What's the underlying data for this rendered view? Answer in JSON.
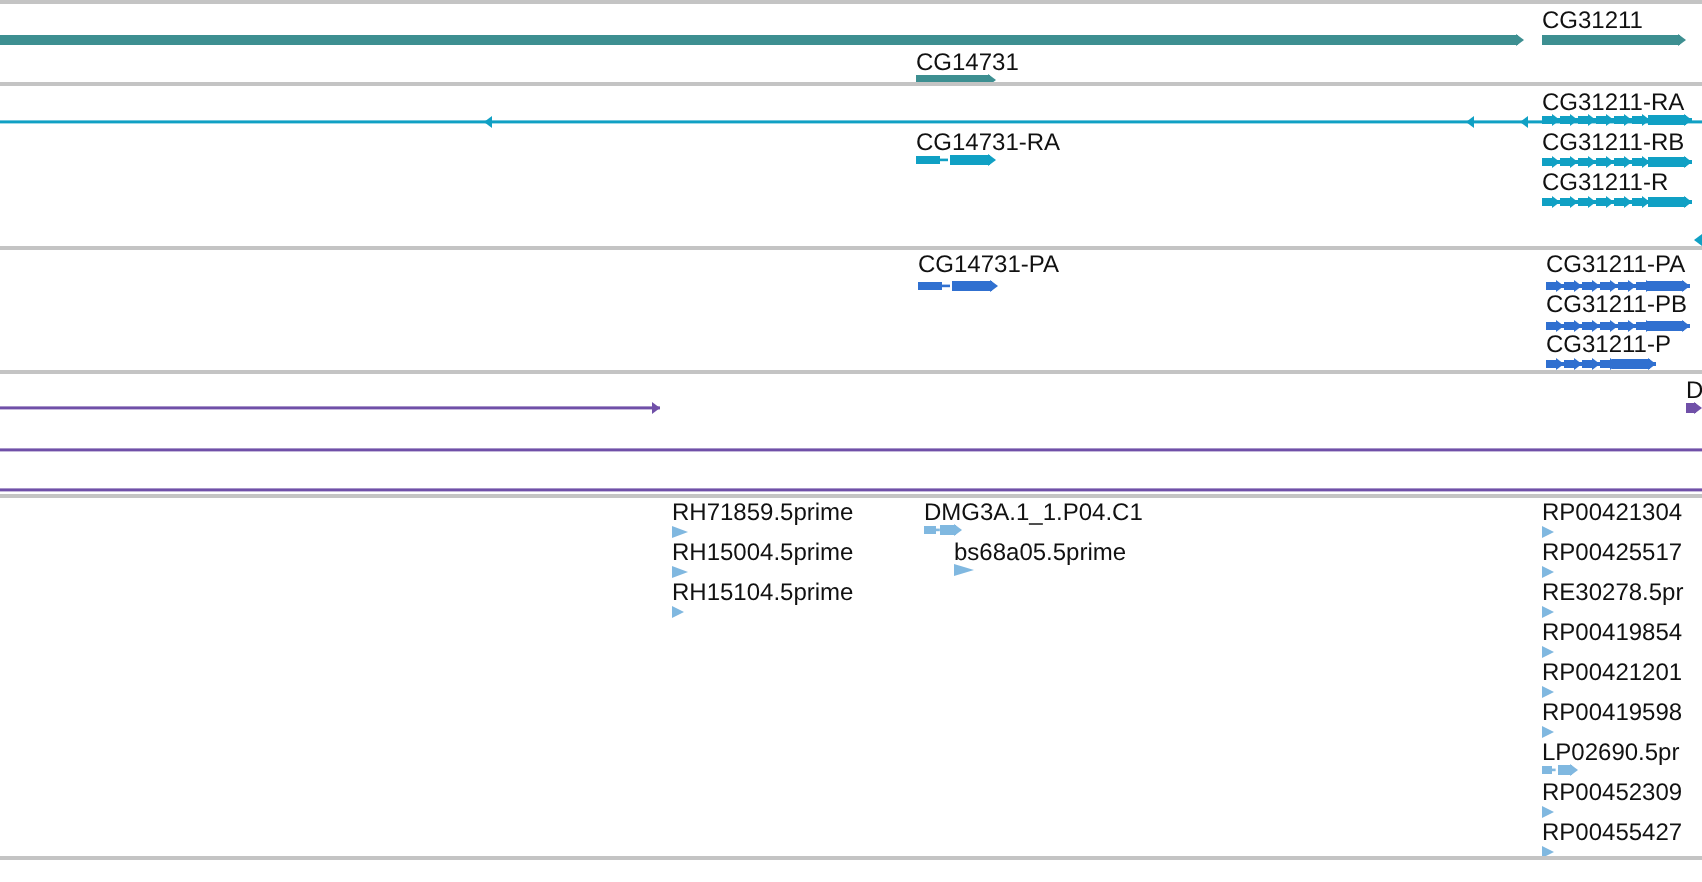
{
  "tracks": [
    {
      "kind": "gene",
      "color": "#3d8f91",
      "features": [
        {
          "reverse": false
        },
        {
          "label": "CG31211",
          "reverse": false
        },
        {
          "label": "CG14731",
          "reverse": false
        }
      ]
    },
    {
      "kind": "transcript",
      "color": "#10a0c4",
      "features": [
        {
          "reverse": true
        },
        {
          "label": "CG31211-RA",
          "reverse": false
        },
        {
          "label": "CG14731-RA",
          "reverse": false
        },
        {
          "label": "CG31211-RB",
          "reverse": false
        },
        {
          "label": "CG31211-R",
          "reverse": false
        },
        {
          "reverse": true
        }
      ]
    },
    {
      "kind": "protein",
      "color": "#3070d0",
      "features": [
        {
          "label": "CG14731-PA",
          "reverse": false
        },
        {
          "label": "CG31211-PA",
          "reverse": false
        },
        {
          "label": "CG31211-PB",
          "reverse": false
        },
        {
          "label": "CG31211-P",
          "reverse": false
        }
      ]
    },
    {
      "kind": "match",
      "color": "#7050a8",
      "features": [
        {
          "reverse": false,
          "arrows": true
        },
        {
          "arrows": false
        },
        {
          "arrows": false
        },
        {
          "label": "D",
          "reverse": false,
          "arrows": true
        }
      ]
    },
    {
      "kind": "est",
      "color": "#80b8e0",
      "features": [
        {
          "label": "RH71859.5prime",
          "reverse": false
        },
        {
          "label": "RH15004.5prime",
          "reverse": false
        },
        {
          "label": "RH15104.5prime",
          "reverse": false
        },
        {
          "label": "DMG3A.1_1.P04.C1",
          "reverse": false
        },
        {
          "label": "bs68a05.5prime",
          "reverse": false
        },
        {
          "label": "RP00421304",
          "reverse": false
        },
        {
          "label": "RP00425517",
          "reverse": false
        },
        {
          "label": "RE30278.5pr",
          "reverse": false
        },
        {
          "label": "RP00419854",
          "reverse": false
        },
        {
          "label": "RP00421201",
          "reverse": false
        },
        {
          "label": "RP00419598",
          "reverse": false
        },
        {
          "label": "LP02690.5pr",
          "reverse": false
        },
        {
          "label": "RP00452309",
          "reverse": false
        },
        {
          "label": "RP00455427",
          "reverse": false
        }
      ]
    }
  ]
}
